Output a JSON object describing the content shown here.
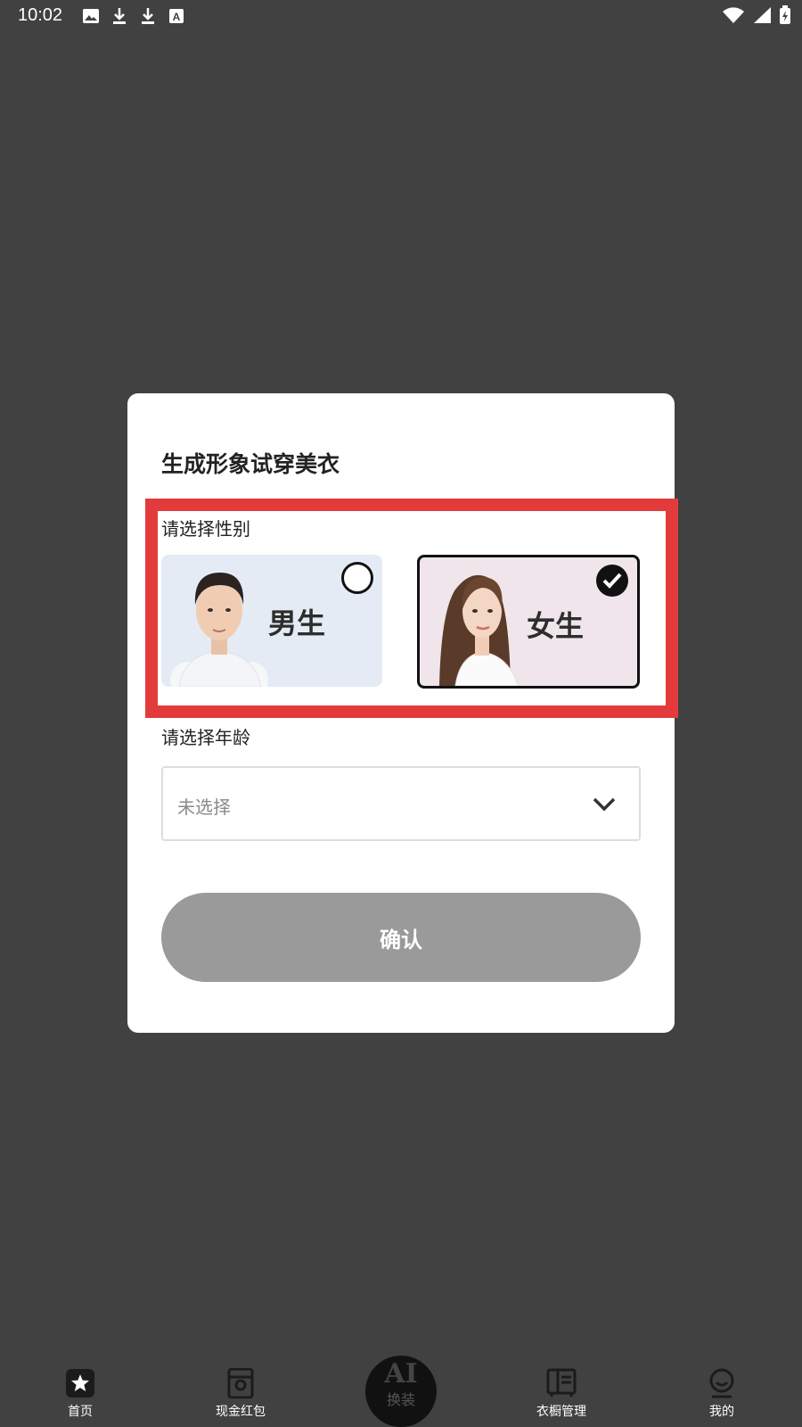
{
  "status": {
    "time": "10:02",
    "icons": [
      "image-icon",
      "download-icon",
      "download-icon",
      "a-icon",
      "wifi-icon",
      "signal-icon",
      "battery-icon"
    ]
  },
  "modal": {
    "title": "生成形象试穿美衣",
    "gender_label": "请选择性别",
    "genders": [
      {
        "label": "男生",
        "selected": false
      },
      {
        "label": "女生",
        "selected": true
      }
    ],
    "age_label": "请选择年龄",
    "age_select": {
      "value": "未选择"
    },
    "confirm_label": "确认"
  },
  "nav": {
    "items": [
      {
        "label": "首页",
        "icon": "star-icon"
      },
      {
        "label": "现金红包",
        "icon": "wallet-icon"
      },
      {
        "label": "AI",
        "sub": "换装",
        "icon": "ai-button"
      },
      {
        "label": "衣橱管理",
        "icon": "wardrobe-icon"
      },
      {
        "label": "我的",
        "icon": "user-icon"
      }
    ]
  },
  "colors": {
    "background": "#414141",
    "highlight": "#e33b3b",
    "confirm_disabled": "#9a9a9a"
  }
}
